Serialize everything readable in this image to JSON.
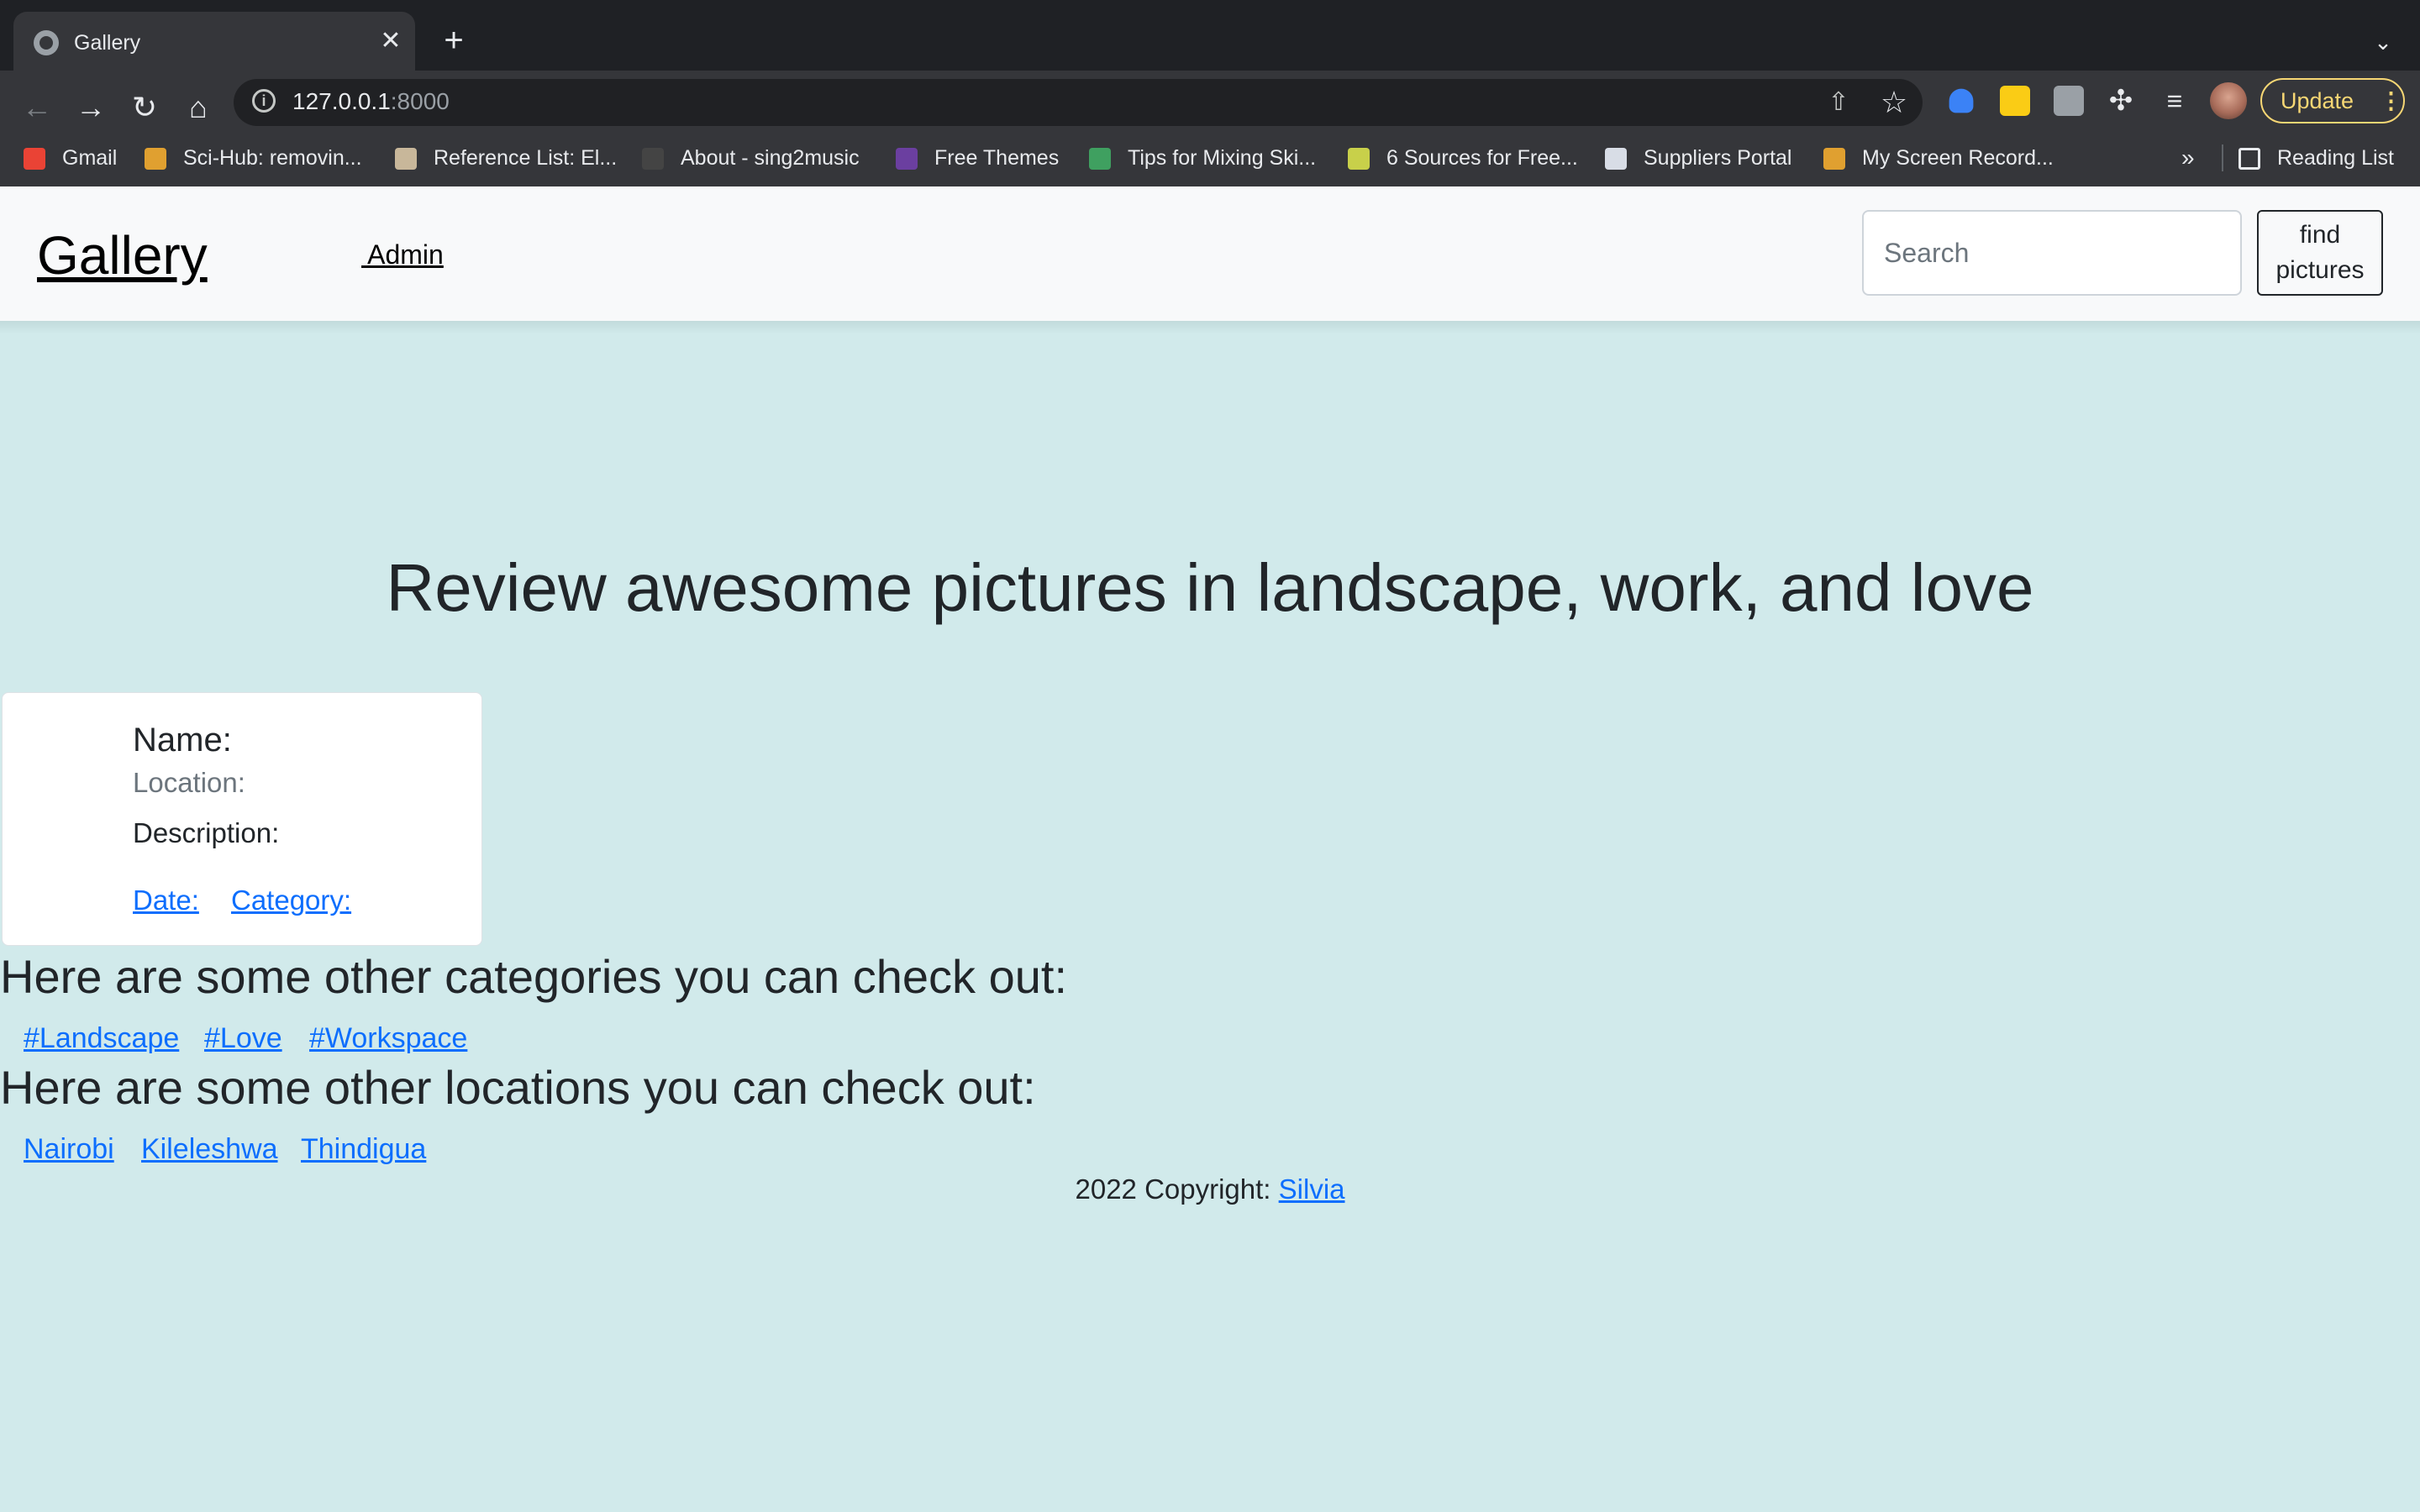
{
  "browser": {
    "tab_title": "Gallery",
    "tab_close": "✕",
    "new_tab": "+",
    "tab_list": "⌄",
    "url_host": "127.0.0.1",
    "url_port": ":8000",
    "update_label": "Update",
    "update_menu": "⋮",
    "bookmarks": [
      {
        "label": "Gmail",
        "icon": "gmail-icon",
        "color": "#ea4335"
      },
      {
        "label": "Sci-Hub: removin...",
        "icon": "scihub-icon",
        "color": "#e0a030"
      },
      {
        "label": "Reference List: El...",
        "icon": "owl-icon",
        "color": "#c8b79a"
      },
      {
        "label": "About - sing2music",
        "icon": "sing2music-icon",
        "color": "#444444"
      },
      {
        "label": "Free Themes",
        "icon": "colorlib-icon",
        "color": "#6b3fa0"
      },
      {
        "label": "Tips for Mixing Ski...",
        "icon": "scissors-icon",
        "color": "#3fa060"
      },
      {
        "label": "6 Sources for Free...",
        "icon": "bracket-icon",
        "color": "#c8d04a"
      },
      {
        "label": "Suppliers Portal",
        "icon": "document-icon",
        "color": "#d8dde6"
      },
      {
        "label": "My Screen Record...",
        "icon": "screen-record-icon",
        "color": "#e0a030"
      }
    ],
    "bookmarks_overflow": "»",
    "reading_list": "Reading List"
  },
  "navbar": {
    "brand": "Gallery",
    "admin": " Admin",
    "search_placeholder": "Search",
    "find_button": "find pictures"
  },
  "hero": {
    "title": "Review awesome pictures in landscape, work, and love"
  },
  "card": {
    "name_label": "Name:",
    "location_label": "Location:",
    "description_label": "Description:",
    "date_label": "Date:",
    "category_label": "Category:"
  },
  "categories": {
    "heading": "Here are some other categories you can check out:",
    "items": [
      "#Landscape",
      "#Love",
      "#Workspace"
    ]
  },
  "locations": {
    "heading": "Here are some other locations you can check out:",
    "items": [
      "Nairobi",
      "Kileleshwa",
      "Thindigua"
    ]
  },
  "footer": {
    "text": "2022 Copyright: ",
    "link": "Silvia"
  },
  "colors": {
    "page_background": "#d1eaeb",
    "navbar_background": "#f8f9fa",
    "link": "#0d6efd",
    "browser_chrome": "#35363a"
  }
}
